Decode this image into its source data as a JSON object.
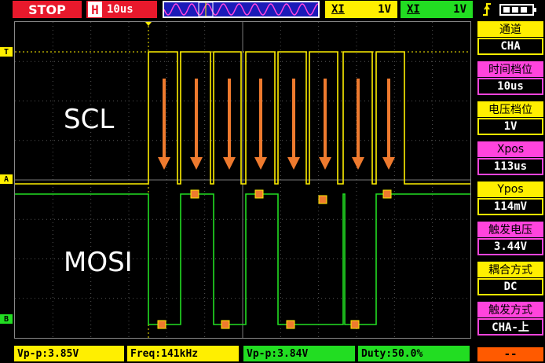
{
  "topbar": {
    "status": "STOP",
    "timebase_key": "H",
    "timebase": "10us",
    "ch_a_label": "XI",
    "ch_a_scale": "1V",
    "ch_b_label": "XI",
    "ch_b_scale": "1V",
    "trigger_icon": "trigger-edge-icon",
    "battery_icon": "battery-icon"
  },
  "screen": {
    "label_top": "SCL",
    "label_bottom": "MOSI",
    "markers": {
      "trigger": "T",
      "ch_a": "A",
      "ch_b": "B"
    }
  },
  "panel": [
    {
      "header": "通道",
      "value": "CHA",
      "color": "#ffef00"
    },
    {
      "header": "时间档位",
      "value": "10us",
      "color": "#ff44dd"
    },
    {
      "header": "电压档位",
      "value": "1V",
      "color": "#ffef00"
    },
    {
      "header": "Xpos",
      "value": "113us",
      "color": "#ff44dd"
    },
    {
      "header": "Ypos",
      "value": "114mV",
      "color": "#ffef00"
    },
    {
      "header": "触发电压",
      "value": "3.44V",
      "color": "#ff44dd"
    },
    {
      "header": "耦合方式",
      "value": "DC",
      "color": "#ffef00"
    },
    {
      "header": "触发方式",
      "value": "CHA-上",
      "color": "#ff44dd"
    }
  ],
  "panel_footer": "--",
  "bottom": {
    "vpp_a": "Vp-p:3.85V",
    "freq_a": "Freq:141kHz",
    "vpp_b": "Vp-p:3.84V",
    "duty_b": "Duty:50.0%"
  },
  "colors": {
    "yellow": "#ffef00",
    "green": "#22dd22",
    "red": "#e8192c",
    "magenta": "#ff44dd",
    "orange": "#ee7a2e"
  }
}
